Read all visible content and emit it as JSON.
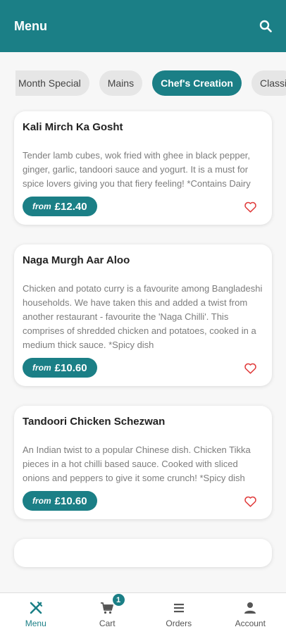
{
  "header": {
    "title": "Menu"
  },
  "categories": [
    {
      "label": "Month Special"
    },
    {
      "label": "Mains"
    },
    {
      "label": "Chef's Creation"
    },
    {
      "label": "Classi"
    }
  ],
  "dishes": [
    {
      "name": "Kali Mirch Ka Gosht",
      "description": "Tender lamb cubes, wok fried with ghee in black pepper, ginger, garlic, tandoori sauce and yogurt. It is a must for spice lovers giving you that fiery feeling! *Contains Dairy",
      "from_label": "from",
      "price": "£12.40"
    },
    {
      "name": "Naga Murgh Aar Aloo",
      "description": "Chicken and potato curry is a favourite among Bangladeshi households. We have taken this and added a twist from another restaurant - favourite the 'Naga Chilli'. This comprises of shredded chicken and potatoes, cooked in a medium thick sauce. *Spicy dish",
      "from_label": "from",
      "price": "£10.60"
    },
    {
      "name": "Tandoori Chicken Schezwan",
      "description": "An Indian twist to a popular Chinese dish. Chicken Tikka pieces in a hot chilli based sauce. Cooked with sliced onions and peppers to give it some crunch! *Spicy dish",
      "from_label": "from",
      "price": "£10.60"
    }
  ],
  "nav": {
    "menu": "Menu",
    "cart": "Cart",
    "cart_count": "1",
    "orders": "Orders",
    "account": "Account"
  },
  "colors": {
    "accent": "#1b7f86",
    "heart": "#e03a3a"
  }
}
